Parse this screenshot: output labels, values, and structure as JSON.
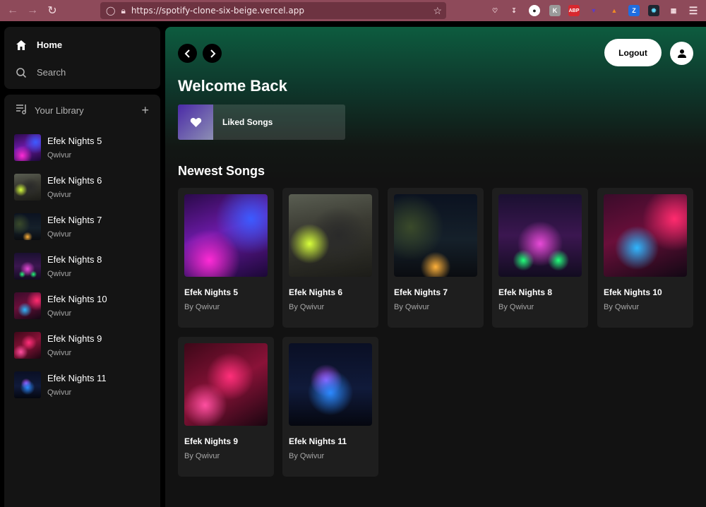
{
  "browser": {
    "url": "https://spotify-clone-six-beige.vercel.app"
  },
  "sidebar": {
    "nav": [
      {
        "label": "Home",
        "icon": "home-icon"
      },
      {
        "label": "Search",
        "icon": "search-icon"
      }
    ],
    "library_title": "Your Library",
    "library_items": [
      {
        "title": "Efek Nights 5",
        "artist": "Qwivur"
      },
      {
        "title": "Efek Nights 6",
        "artist": "Qwivur"
      },
      {
        "title": "Efek Nights 7",
        "artist": "Qwivur"
      },
      {
        "title": "Efek Nights 8",
        "artist": "Qwivur"
      },
      {
        "title": "Efek Nights 10",
        "artist": "Qwivur"
      },
      {
        "title": "Efek Nights 9",
        "artist": "Qwivur"
      },
      {
        "title": "Efek Nights 11",
        "artist": "Qwivur"
      }
    ]
  },
  "header": {
    "logout_label": "Logout"
  },
  "main": {
    "welcome": "Welcome Back",
    "liked_songs": "Liked Songs",
    "newest_title": "Newest Songs",
    "songs": [
      {
        "title": "Efek Nights 5",
        "artist": "By Qwivur"
      },
      {
        "title": "Efek Nights 6",
        "artist": "By Qwivur"
      },
      {
        "title": "Efek Nights 7",
        "artist": "By Qwivur"
      },
      {
        "title": "Efek Nights 8",
        "artist": "By Qwivur"
      },
      {
        "title": "Efek Nights 10",
        "artist": "By Qwivur"
      },
      {
        "title": "Efek Nights 9",
        "artist": "By Qwivur"
      },
      {
        "title": "Efek Nights 11",
        "artist": "By Qwivur"
      }
    ]
  },
  "colors": {
    "accent_gradient_top": "#0d5c3f",
    "background": "#121212",
    "panel": "#141414",
    "card": "#1e1e1e",
    "browser_chrome": "#8e4a5a"
  }
}
